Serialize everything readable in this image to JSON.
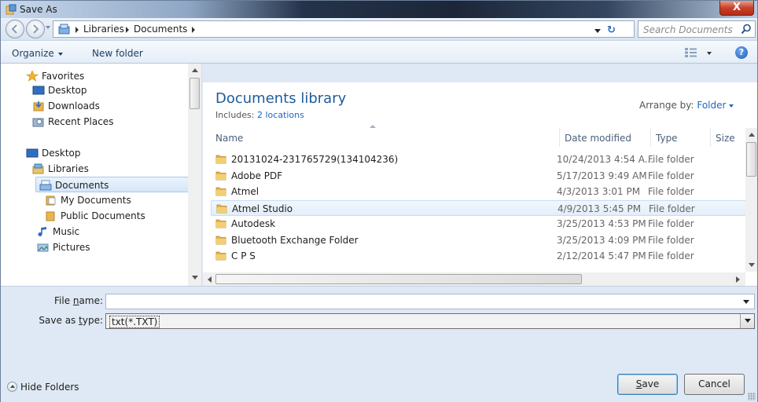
{
  "window": {
    "title": "Save As",
    "close_label": "X"
  },
  "address": {
    "breadcrumbs": [
      "Libraries",
      "Documents"
    ],
    "search_placeholder": "Search Documents"
  },
  "toolbar": {
    "organize": "Organize",
    "new_folder": "New folder",
    "help": "?"
  },
  "nav": {
    "favorites": "Favorites",
    "desktop_fav": "Desktop",
    "downloads": "Downloads",
    "recent": "Recent Places",
    "desktop": "Desktop",
    "libraries": "Libraries",
    "documents": "Documents",
    "my_documents": "My Documents",
    "public_documents": "Public Documents",
    "music": "Music",
    "pictures": "Pictures"
  },
  "library": {
    "title": "Documents library",
    "includes_prefix": "Includes:",
    "includes_link": "2 locations",
    "arrange_label": "Arrange by:",
    "arrange_value": "Folder"
  },
  "columns": {
    "name": "Name",
    "date": "Date modified",
    "type": "Type",
    "size": "Size"
  },
  "files": [
    {
      "name": "20131024-231765729(134104236)",
      "date": "10/24/2013 4:54 A...",
      "type": "File folder"
    },
    {
      "name": "Adobe PDF",
      "date": "5/17/2013 9:49 AM",
      "type": "File folder"
    },
    {
      "name": "Atmel",
      "date": "4/3/2013 3:01 PM",
      "type": "File folder"
    },
    {
      "name": "Atmel Studio",
      "date": "4/9/2013 5:45 PM",
      "type": "File folder"
    },
    {
      "name": "Autodesk",
      "date": "3/25/2013 4:53 PM",
      "type": "File folder"
    },
    {
      "name": "Bluetooth Exchange Folder",
      "date": "3/25/2013 4:09 PM",
      "type": "File folder"
    },
    {
      "name": "C P S",
      "date": "2/12/2014 5:47 PM",
      "type": "File folder"
    }
  ],
  "highlighted_row_index": 3,
  "form": {
    "filename_label_pre": "File ",
    "filename_label_u": "n",
    "filename_label_post": "ame:",
    "filename_value": "",
    "savetype_label_pre": "Save as ",
    "savetype_label_u": "t",
    "savetype_label_post": "ype:",
    "savetype_value": "txt(*.TXT)"
  },
  "footer": {
    "hide_folders": "Hide Folders",
    "save_u": "S",
    "save_rest": "ave",
    "cancel": "Cancel"
  },
  "colors": {
    "accent": "#1e5c9c",
    "link": "#1e66c8",
    "close": "#c8402a"
  }
}
